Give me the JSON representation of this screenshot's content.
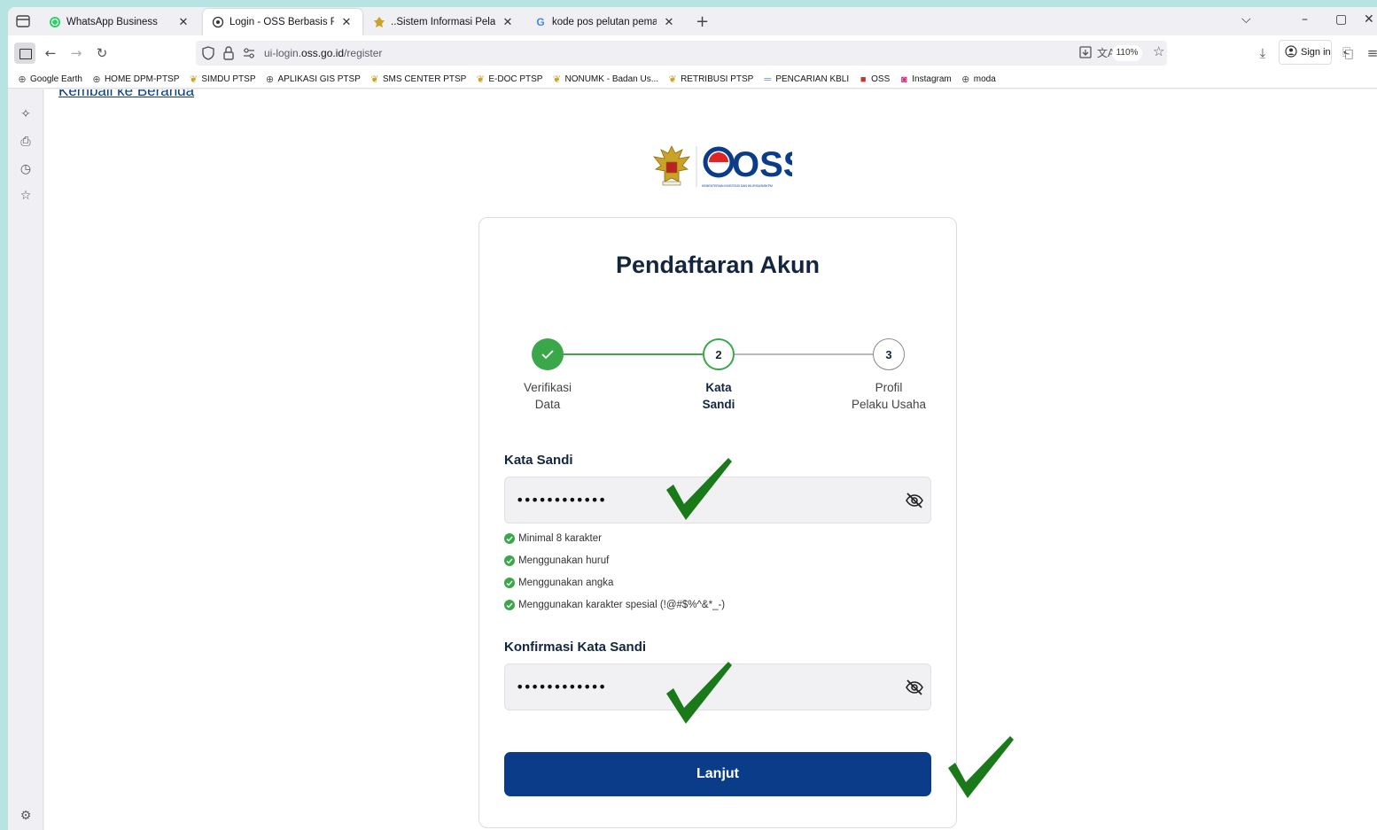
{
  "browser": {
    "tabs": [
      {
        "title": "WhatsApp Business",
        "icon": "whatsapp-icon"
      },
      {
        "title": "Login - OSS Berbasis Risiko",
        "icon": "page-icon",
        "active": true
      },
      {
        "title": "..Sistem Informasi Pelayanan Pe",
        "icon": "garuda-icon"
      },
      {
        "title": "kode pos pelutan pemalang - P",
        "icon": "google-icon"
      }
    ],
    "url_prefix": "ui-login.",
    "url_domain": "oss.go.id",
    "url_path": "/register",
    "zoom": "110%",
    "sign_in": "Sign in",
    "bookmarks": [
      {
        "label": "Google Earth",
        "icon": "globe-icon"
      },
      {
        "label": "HOME DPM-PTSP",
        "icon": "globe-icon"
      },
      {
        "label": "SIMDU PTSP",
        "icon": "garuda-icon"
      },
      {
        "label": "APLIKASI GIS PTSP",
        "icon": "globe-icon"
      },
      {
        "label": "SMS CENTER PTSP",
        "icon": "garuda-icon"
      },
      {
        "label": "E-DOC PTSP",
        "icon": "garuda-icon"
      },
      {
        "label": "NONUMK - Badan Us...",
        "icon": "garuda-icon"
      },
      {
        "label": "RETRIBUSI PTSP",
        "icon": "garuda-icon"
      },
      {
        "label": "PENCARIAN KBLI",
        "icon": "dash-icon"
      },
      {
        "label": "OSS",
        "icon": "oss-icon"
      },
      {
        "label": "Instagram",
        "icon": "instagram-icon"
      },
      {
        "label": "moda",
        "icon": "globe-icon"
      }
    ]
  },
  "page": {
    "back_link": "Kembali ke Beranda",
    "logo_text": "OSS",
    "logo_subtext": "KEMENTERIAN INVESTASI DAN HILIRISASI/BKPM",
    "title": "Pendaftaran Akun",
    "steps": [
      {
        "number": "",
        "label": "Verifikasi\nData",
        "state": "done"
      },
      {
        "number": "2",
        "label": "Kata\nSandi",
        "state": "active"
      },
      {
        "number": "3",
        "label": "Profil\nPelaku Usaha",
        "state": "pending"
      }
    ],
    "password_label": "Kata Sandi",
    "password_value": "••••••••••••",
    "requirements": [
      "Minimal 8 karakter",
      "Menggunakan huruf",
      "Menggunakan angka",
      "Menggunakan karakter spesial (!@#$%^&*_-)"
    ],
    "confirm_label": "Konfirmasi Kata Sandi",
    "confirm_value": "••••••••••••",
    "submit_label": "Lanjut"
  },
  "colors": {
    "primary": "#0a3c8a",
    "success": "#3aa84a",
    "annotation_check": "#1a7a1a"
  }
}
